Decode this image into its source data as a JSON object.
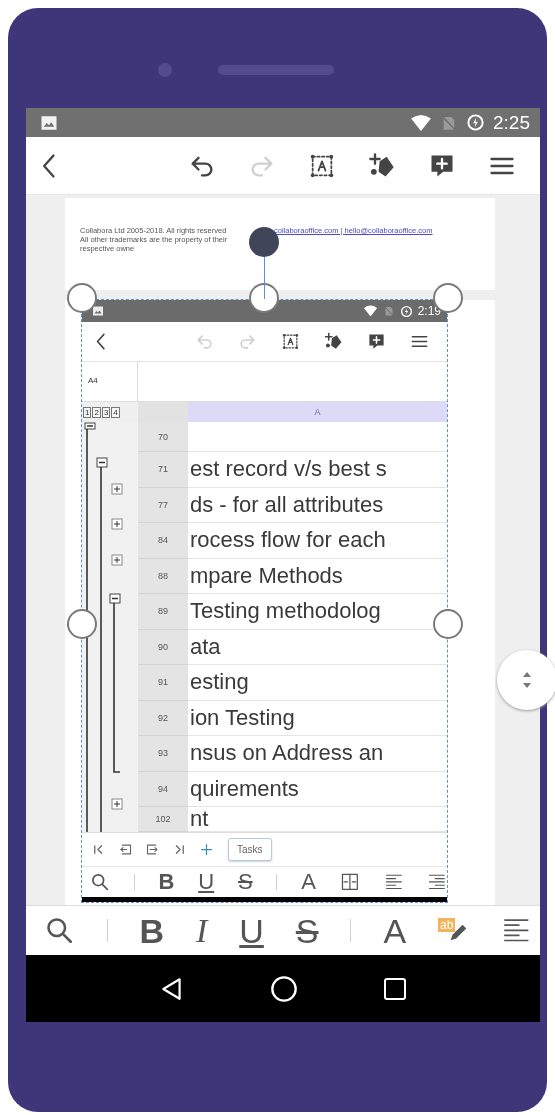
{
  "status_bar": {
    "time": "2:25"
  },
  "toolbar": [
    {
      "kind": "back",
      "disabled": false
    },
    {
      "kind": "undo",
      "disabled": false
    },
    {
      "kind": "redo",
      "disabled": true
    },
    {
      "kind": "text-box",
      "disabled": false
    },
    {
      "kind": "shapes",
      "disabled": false
    },
    {
      "kind": "comment",
      "disabled": false
    },
    {
      "kind": "menu",
      "disabled": false
    }
  ],
  "header_page": {
    "copyright": "Collabora Ltd 2005-2018. All rights reserved",
    "trademarks": "All other trademarks are the property of their respective owne",
    "links": "collaboraoffice.com | hello@collaboraoffice.com"
  },
  "embedded_screenshot": {
    "status_time": "2:19",
    "toolbar": [
      {
        "kind": "back",
        "disabled": false
      },
      {
        "kind": "undo",
        "disabled": true
      },
      {
        "kind": "redo",
        "disabled": true
      },
      {
        "kind": "text-box",
        "disabled": false
      },
      {
        "kind": "shapes",
        "disabled": false
      },
      {
        "kind": "comment",
        "disabled": false
      },
      {
        "kind": "menu",
        "disabled": false
      }
    ],
    "cell_reference": "A4",
    "outline_levels": [
      "1",
      "2",
      "3",
      "4"
    ],
    "column": "A",
    "rows": [
      {
        "number": "70"
      },
      {
        "number": "71",
        "text": "est record v/s best s"
      },
      {
        "number": "77",
        "text": "ds - for all attributes"
      },
      {
        "number": "84",
        "text": "rocess flow for each"
      },
      {
        "number": "88",
        "text": "mpare Methods"
      },
      {
        "number": "89",
        "text": "Testing methodolog"
      },
      {
        "number": "90",
        "text": "ata"
      },
      {
        "number": "91",
        "text": "esting"
      },
      {
        "number": "92",
        "text": "ion Testing"
      },
      {
        "number": "93",
        "text": "nsus on Address an"
      },
      {
        "number": "94",
        "text": "quirements"
      },
      {
        "number": "102",
        "text": "nt"
      }
    ],
    "sheet_nav": [
      {
        "kind": "first"
      },
      {
        "kind": "prev"
      },
      {
        "kind": "next"
      },
      {
        "kind": "last"
      },
      {
        "kind": "add"
      }
    ],
    "sheet_tabs": [
      {
        "label": "Tasks",
        "selected": true
      }
    ],
    "format_bar": [
      {
        "kind": "search"
      },
      {
        "kind": "separator"
      },
      {
        "kind": "bold",
        "label": "B"
      },
      {
        "kind": "underline",
        "label": "U"
      },
      {
        "kind": "strike",
        "label": "S"
      },
      {
        "kind": "separator"
      },
      {
        "kind": "font-color",
        "label": "A"
      },
      {
        "kind": "merge"
      },
      {
        "kind": "align-left"
      },
      {
        "kind": "align-right"
      }
    ]
  },
  "format_bar": [
    {
      "kind": "search"
    },
    {
      "kind": "separator"
    },
    {
      "kind": "bold",
      "label": "B"
    },
    {
      "kind": "italic",
      "label": "I"
    },
    {
      "kind": "underline",
      "label": "U"
    },
    {
      "kind": "strike",
      "label": "S"
    },
    {
      "kind": "separator"
    },
    {
      "kind": "font-color",
      "label": "A"
    },
    {
      "kind": "highlight",
      "label": "ab"
    },
    {
      "kind": "align-left"
    }
  ]
}
